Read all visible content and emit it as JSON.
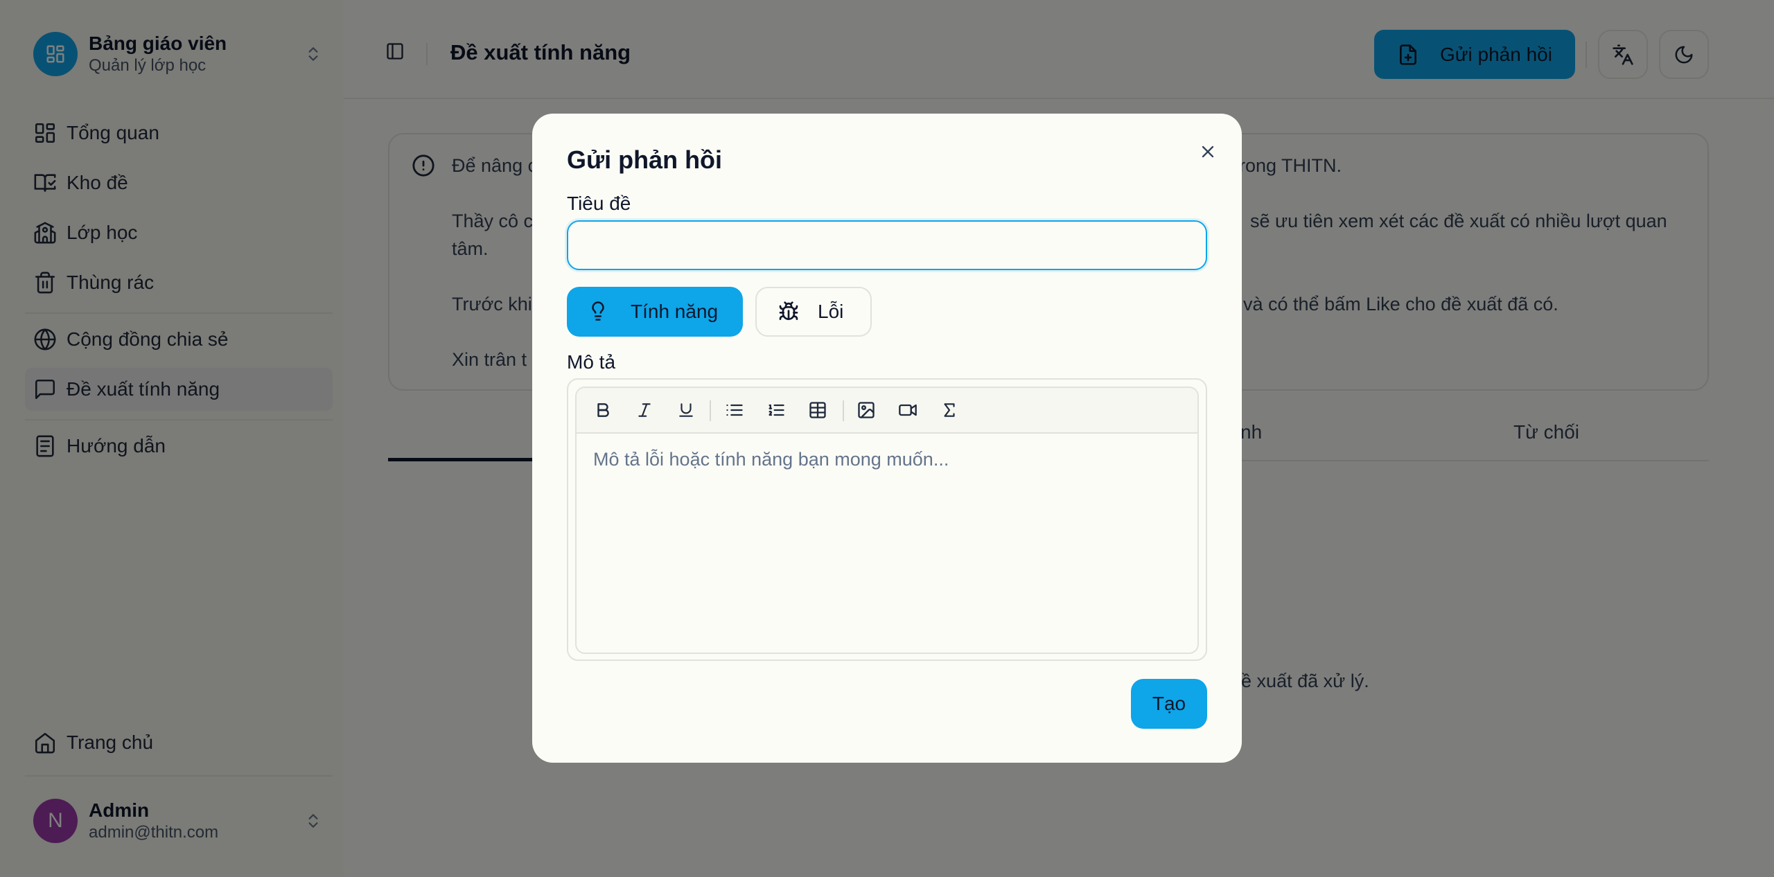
{
  "sidebar": {
    "brand": {
      "title": "Bảng giáo viên",
      "subtitle": "Quản lý lớp học"
    },
    "items": [
      {
        "label": "Tổng quan",
        "icon": "dashboard-icon"
      },
      {
        "label": "Kho đề",
        "icon": "book-icon"
      },
      {
        "label": "Lớp học",
        "icon": "school-icon"
      },
      {
        "label": "Thùng rác",
        "icon": "trash-icon"
      },
      {
        "label": "Cộng đồng chia sẻ",
        "icon": "globe-icon"
      },
      {
        "label": "Đề xuất tính năng",
        "icon": "message-icon",
        "active": true
      },
      {
        "label": "Hướng dẫn",
        "icon": "document-icon"
      }
    ],
    "bottom_item": {
      "label": "Trang chủ",
      "icon": "home-icon"
    },
    "user": {
      "initial": "N",
      "name": "Admin",
      "email": "admin@thitn.com"
    }
  },
  "header": {
    "title": "Đề xuất tính năng",
    "send_feedback_label": "Gửi phản hồi"
  },
  "info": {
    "line1_left": "Để nâng c",
    "line1_right": "rong THITN.",
    "line2_left": "Thầy cô c",
    "line2_right": "sẽ ưu tiên xem xét các đề xuất có nhiều lượt quan",
    "line2_cont": "tâm.",
    "line3_left": "Trước khi",
    "line3_right": "và có thể bấm Like cho đề xuất đã có.",
    "line4_left": "Xin trân t"
  },
  "tabs": {
    "partial_label": "nh",
    "rejected_label": "Từ chối"
  },
  "empty_text": "ác đề xuất đã xử lý.",
  "modal": {
    "title": "Gửi phản hồi",
    "title_label": "Tiêu đề",
    "title_value": "",
    "type_feature": "Tính năng",
    "type_bug": "Lỗi",
    "description_label": "Mô tả",
    "description_placeholder": "Mô tả lỗi hoặc tính năng bạn mong muốn...",
    "create_label": "Tạo"
  },
  "colors": {
    "accent": "#0ea5e9",
    "avatar": "#9b38a8"
  }
}
